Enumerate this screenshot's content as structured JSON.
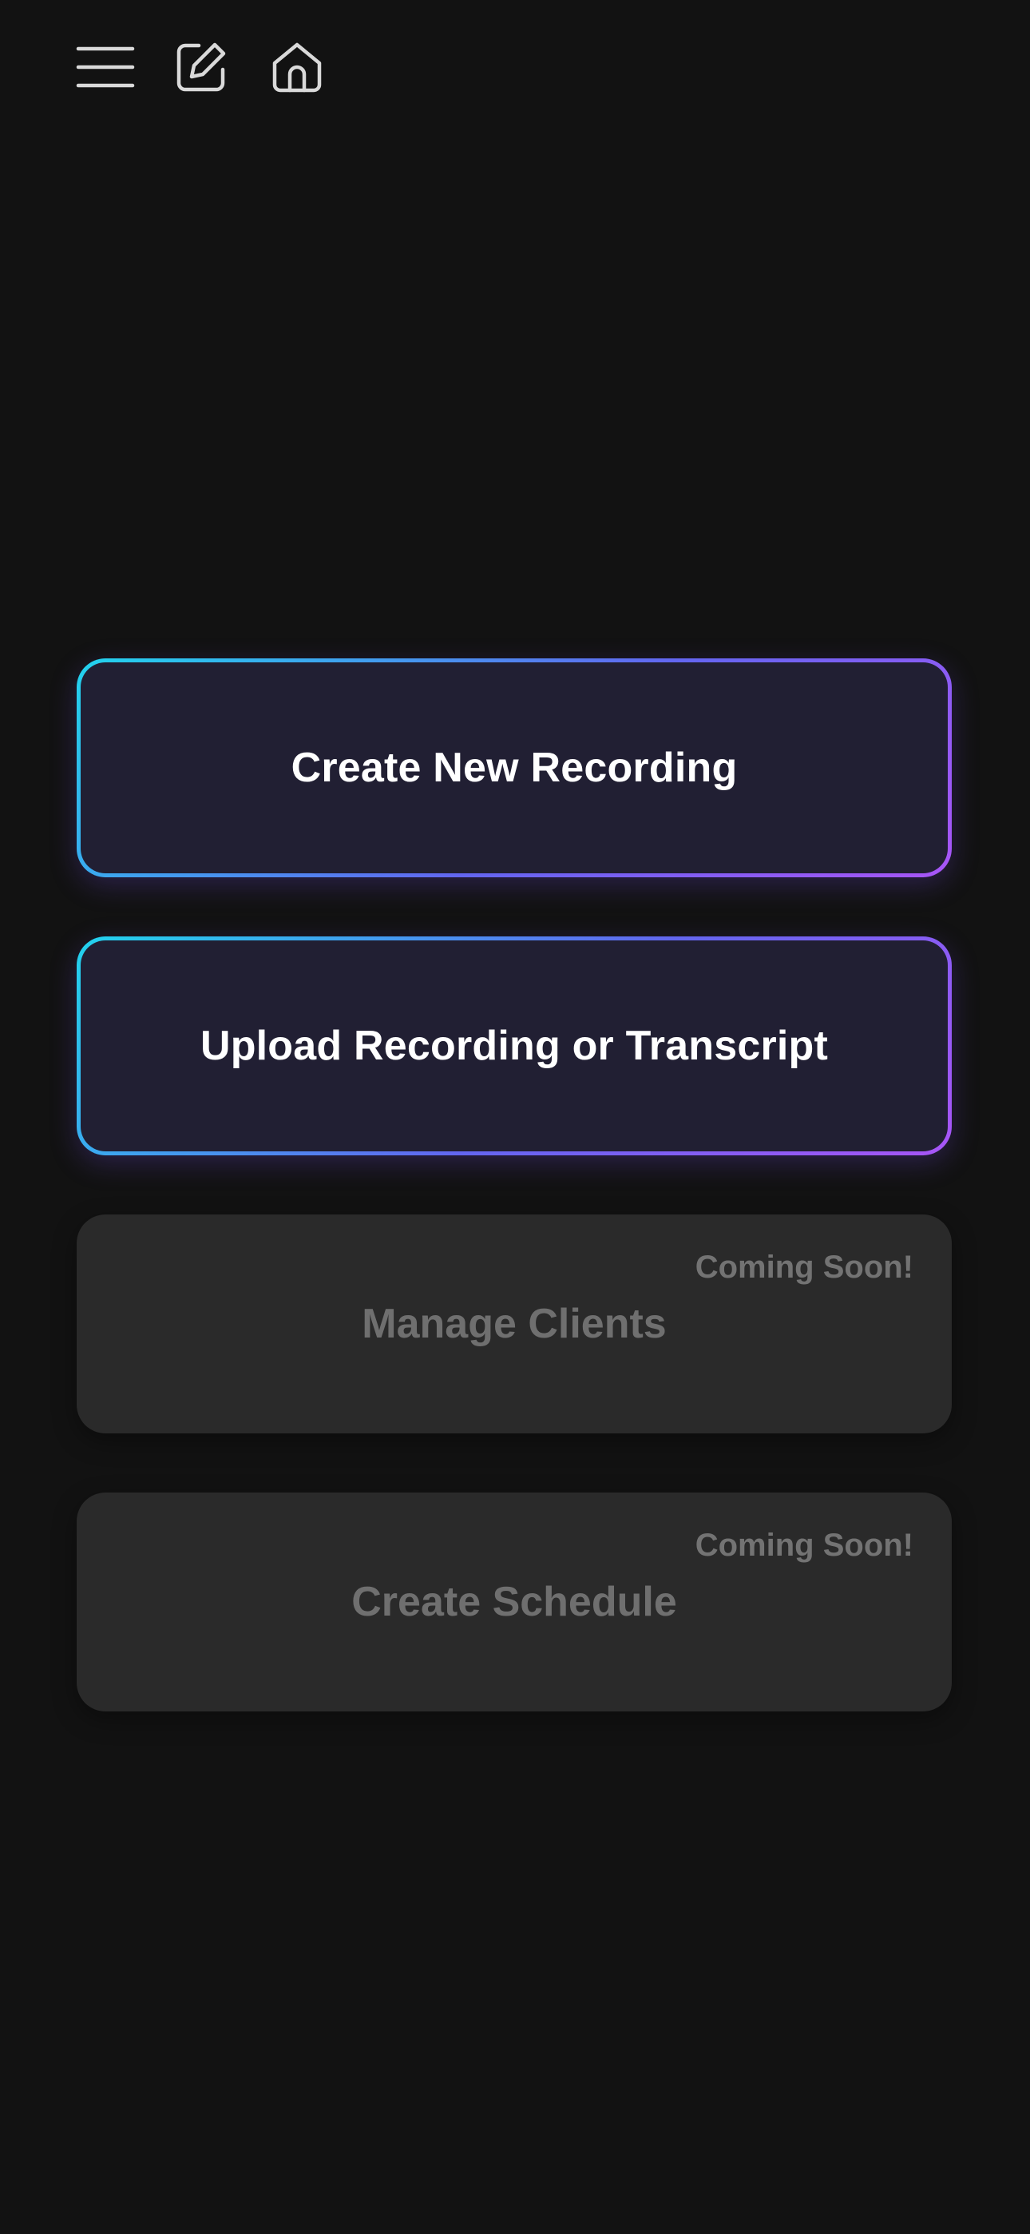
{
  "header": {
    "menu_icon": "hamburger-menu-icon",
    "edit_icon": "edit-icon",
    "home_icon": "home-icon"
  },
  "actions": [
    {
      "label": "Create New Recording",
      "enabled": true
    },
    {
      "label": "Upload Recording or Transcript",
      "enabled": true
    },
    {
      "label": "Manage Clients",
      "enabled": false,
      "badge": "Coming Soon!"
    },
    {
      "label": "Create Schedule",
      "enabled": false,
      "badge": "Coming Soon!"
    }
  ],
  "colors": {
    "background": "#121212",
    "primary_card": "#211f33",
    "gradient_start": "#22d3ee",
    "gradient_end": "#a855f7",
    "disabled_card": "#2a2a2a",
    "disabled_text": "#6f6f6f"
  }
}
